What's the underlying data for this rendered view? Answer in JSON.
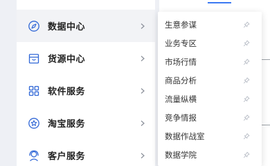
{
  "sidebar": {
    "items": [
      {
        "label": "数据中心",
        "icon": "compass-icon",
        "active": true
      },
      {
        "label": "货源中心",
        "icon": "store-icon",
        "active": false
      },
      {
        "label": "软件服务",
        "icon": "grid-icon",
        "active": false
      },
      {
        "label": "淘宝服务",
        "icon": "star-badge-icon",
        "active": false
      },
      {
        "label": "客户服务",
        "icon": "headset-icon",
        "active": false
      }
    ]
  },
  "flyout": {
    "items": [
      {
        "label": "生意参谋",
        "icon": "pin-icon"
      },
      {
        "label": "业务专区",
        "icon": "pin-icon"
      },
      {
        "label": "市场行情",
        "icon": "pin-icon"
      },
      {
        "label": "商品分析",
        "icon": "pin-icon"
      },
      {
        "label": "流量纵横",
        "icon": "pin-icon"
      },
      {
        "label": "竞争情报",
        "icon": "pin-icon"
      },
      {
        "label": "数据作战室",
        "icon": "pin-icon"
      },
      {
        "label": "数据学院",
        "icon": "pin-icon"
      }
    ]
  },
  "colors": {
    "accent": "#3a78f2",
    "menu_icon": "#2f66d6",
    "active_bg": "#f2f3f6"
  }
}
